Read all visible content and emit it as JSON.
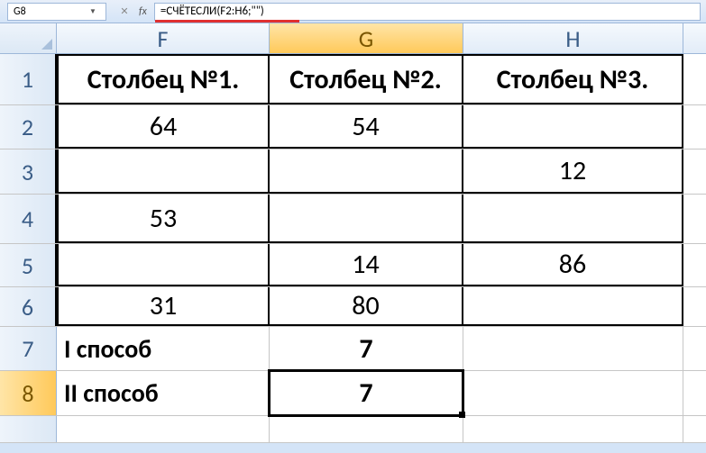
{
  "nameBox": {
    "cellRef": "G8"
  },
  "formulaBar": {
    "formula": "=СЧЁТЕСЛИ(F2:H6;\"\")",
    "fxLabel": "fx"
  },
  "columns": {
    "F": "F",
    "G": "G",
    "H": "H"
  },
  "rows": {
    "1": {
      "F": "Столбец №1.",
      "G": "Столбец №2.",
      "H": "Столбец №3."
    },
    "2": {
      "F": "64",
      "G": "54",
      "H": ""
    },
    "3": {
      "F": "",
      "G": "",
      "H": "12"
    },
    "4": {
      "F": "53",
      "G": "",
      "H": ""
    },
    "5": {
      "F": "",
      "G": "14",
      "H": "86"
    },
    "6": {
      "F": "31",
      "G": "80",
      "H": ""
    },
    "7": {
      "F": "I способ",
      "G": "7",
      "H": ""
    },
    "8": {
      "F": "II способ",
      "G": "7",
      "H": ""
    }
  },
  "rowLabels": [
    "1",
    "2",
    "3",
    "4",
    "5",
    "6",
    "7",
    "8"
  ],
  "activeCell": "G8"
}
